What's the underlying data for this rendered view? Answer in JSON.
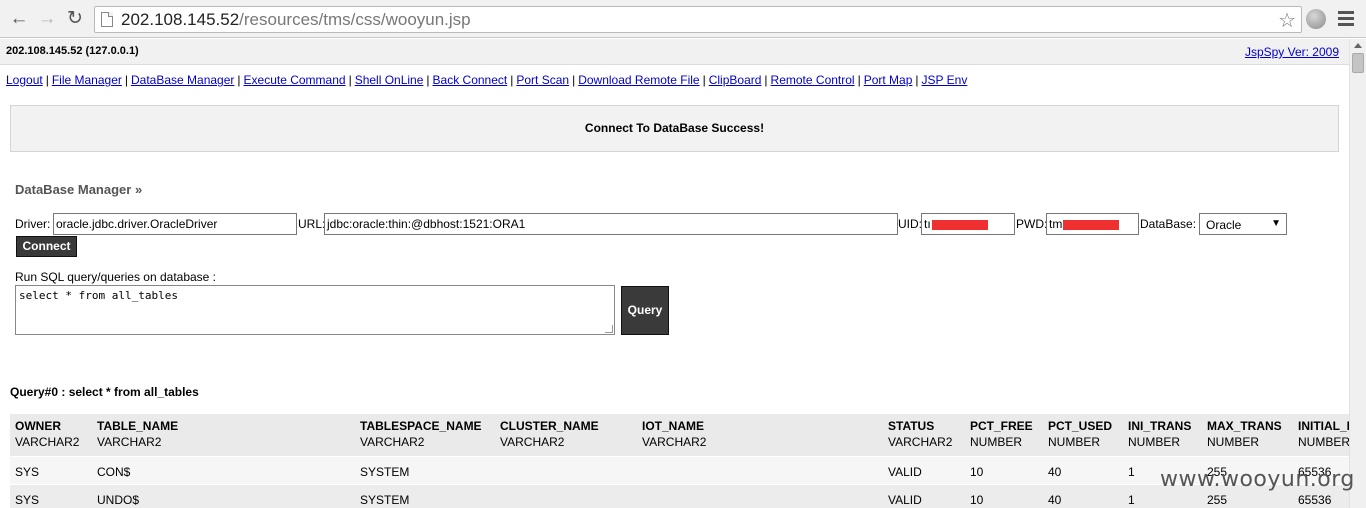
{
  "browser": {
    "url_host": "202.108.145.52",
    "url_path": "/resources/tms/css/wooyun.jsp"
  },
  "header": {
    "host_info": "202.108.145.52 (127.0.0.1)",
    "version_link": "JspSpy Ver: 2009"
  },
  "menu": [
    "Logout",
    "File Manager",
    "DataBase Manager",
    "Execute Command",
    "Shell OnLine",
    "Back Connect",
    "Port Scan",
    "Download Remote File",
    "ClipBoard",
    "Remote Control",
    "Port Map",
    "JSP Env"
  ],
  "message": "Connect To DataBase Success!",
  "section_title": "DataBase Manager »",
  "form": {
    "driver_label": "Driver:",
    "driver_value": "oracle.jdbc.driver.OracleDriver",
    "url_label": "URL:",
    "url_value": "jdbc:oracle:thin:@dbhost:1521:ORA1",
    "uid_label": "UID:",
    "uid_value": "tı",
    "pwd_label": "PWD:",
    "pwd_value": "tm",
    "db_label": "DataBase:",
    "db_value": "Oracle",
    "connect_label": "Connect"
  },
  "sql": {
    "label": "Run SQL query/queries on database :",
    "value": "select * from all_tables",
    "query_button": "Query"
  },
  "results": {
    "title": "Query#0 : select * from all_tables",
    "columns": [
      {
        "name": "OWNER",
        "type": "VARCHAR2"
      },
      {
        "name": "TABLE_NAME",
        "type": "VARCHAR2"
      },
      {
        "name": "TABLESPACE_NAME",
        "type": "VARCHAR2"
      },
      {
        "name": "CLUSTER_NAME",
        "type": "VARCHAR2"
      },
      {
        "name": "IOT_NAME",
        "type": "VARCHAR2"
      },
      {
        "name": "STATUS",
        "type": "VARCHAR2"
      },
      {
        "name": "PCT_FREE",
        "type": "NUMBER"
      },
      {
        "name": "PCT_USED",
        "type": "NUMBER"
      },
      {
        "name": "INI_TRANS",
        "type": "NUMBER"
      },
      {
        "name": "MAX_TRANS",
        "type": "NUMBER"
      },
      {
        "name": "INITIAL_E",
        "type": "NUMBER"
      }
    ],
    "rows": [
      [
        "SYS",
        "CON$",
        "SYSTEM",
        "",
        "",
        "VALID",
        "10",
        "40",
        "1",
        "255",
        "65536"
      ],
      [
        "SYS",
        "UNDO$",
        "SYSTEM",
        "",
        "",
        "VALID",
        "10",
        "40",
        "1",
        "255",
        "65536"
      ]
    ]
  },
  "watermark": "www.wooyun.org"
}
